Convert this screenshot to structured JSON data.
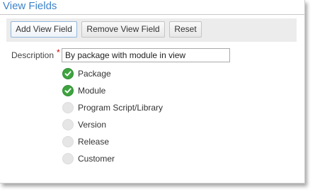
{
  "panel": {
    "title": "View Fields"
  },
  "toolbar": {
    "add_label": "Add View Field",
    "remove_label": "Remove View Field",
    "reset_label": "Reset"
  },
  "description": {
    "label": "Description",
    "required_mark": "*",
    "value": "By package with module in view"
  },
  "fields": [
    {
      "label": "Package",
      "selected": true,
      "icon": "check-circle-icon"
    },
    {
      "label": "Module",
      "selected": true,
      "icon": "check-circle-icon"
    },
    {
      "label": "Program Script/Library",
      "selected": false,
      "icon": "empty-circle-icon"
    },
    {
      "label": "Version",
      "selected": false,
      "icon": "empty-circle-icon"
    },
    {
      "label": "Release",
      "selected": false,
      "icon": "empty-circle-icon"
    },
    {
      "label": "Customer",
      "selected": false,
      "icon": "empty-circle-icon"
    }
  ],
  "colors": {
    "title": "#3e83c9",
    "selected_icon": "#3ea33f",
    "unselected_icon": "#e6e6e6",
    "required": "#d40000"
  }
}
